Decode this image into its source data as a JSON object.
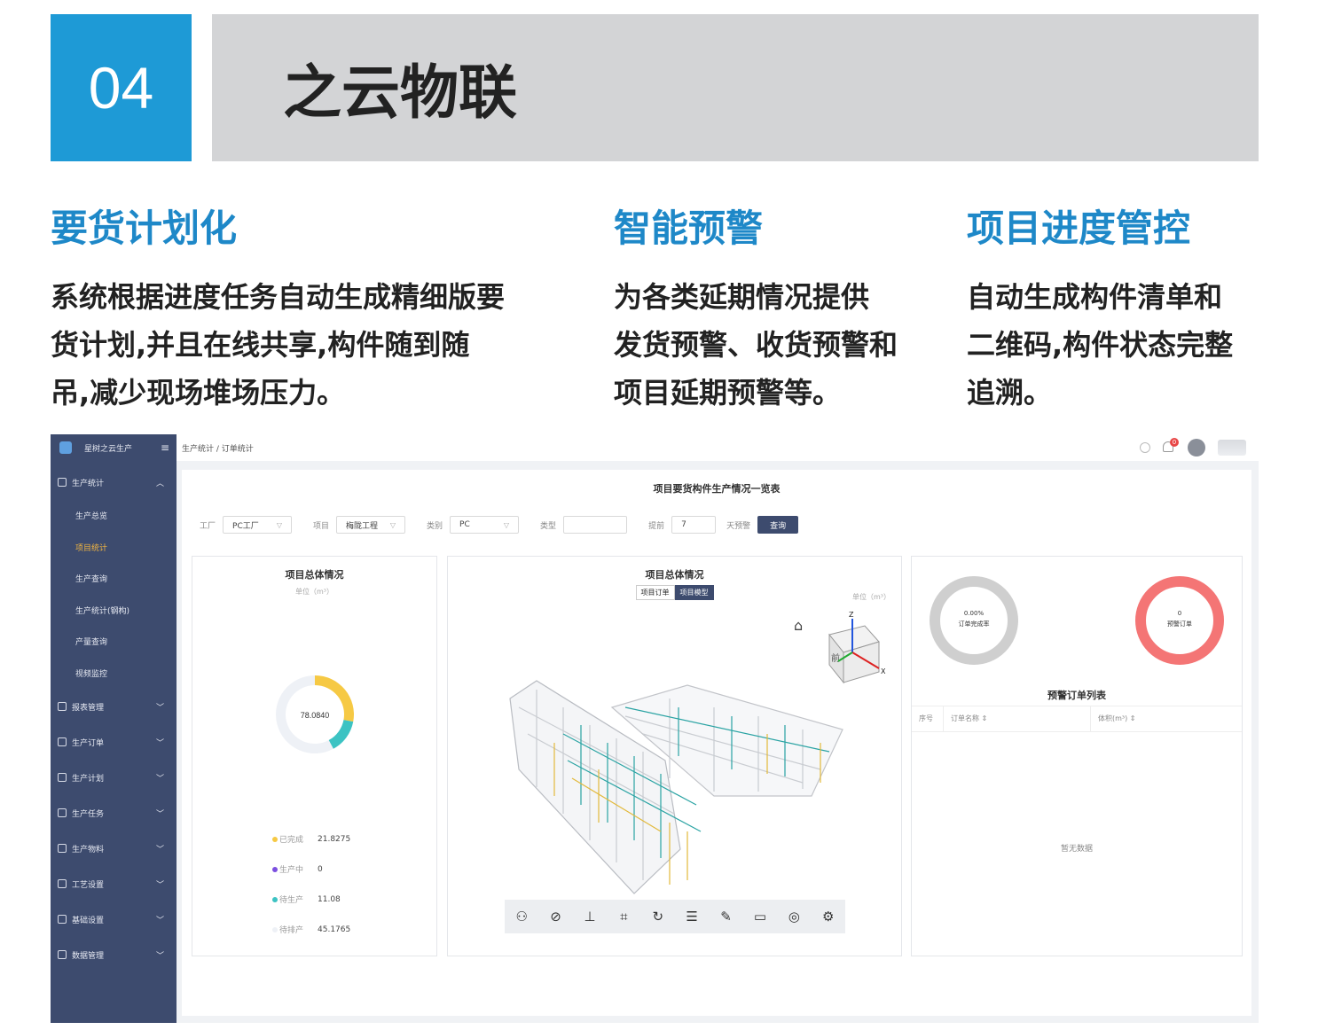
{
  "header": {
    "number": "04",
    "title": "之云物联"
  },
  "features": [
    {
      "title": "要货计划化",
      "desc": [
        "系统根据进度任务自动生成精细版要",
        "货计划,并且在线共享,构件随到随",
        "吊,减少现场堆场压力。"
      ]
    },
    {
      "title": "智能预警",
      "desc": [
        "为各类延期情况提供",
        "发货预警、收货预警和",
        "项目延期预警等。"
      ]
    },
    {
      "title": "项目进度管控",
      "desc": [
        "自动生成构件清单和",
        "二维码,构件状态完整",
        "追溯。"
      ]
    }
  ],
  "app": {
    "brand": "星树之云生产",
    "breadcrumb": "生产统计 / 订单统计",
    "notification_count": "0",
    "sidebar": {
      "group": "生产统计",
      "subitems": [
        "生产总览",
        "项目统计",
        "生产查询",
        "生产统计(钢构)",
        "产量查询",
        "视频监控"
      ],
      "active_sub": "项目统计",
      "items": [
        "报表管理",
        "生产订单",
        "生产计划",
        "生产任务",
        "生产物料",
        "工艺设置",
        "基础设置",
        "数据管理"
      ]
    },
    "page_title": "项目要货构件生产情况一览表",
    "filters": {
      "factory_label": "工厂",
      "factory_value": "PC工厂",
      "project_label": "项目",
      "project_value": "梅陇工程",
      "category_label": "类别",
      "category_value": "PC",
      "type_label": "类型",
      "type_value": "",
      "advance_label": "提前",
      "advance_value": "7",
      "days_warning_label": "天预警",
      "query_button": "查询"
    },
    "panel_left": {
      "title": "项目总体情况",
      "unit": "单位（m³）",
      "center_value": "78.0840",
      "legend": [
        {
          "label": "已完成",
          "value": "21.8275",
          "color": "#f6c944"
        },
        {
          "label": "生产中",
          "value": "0",
          "color": "#7b4fe0"
        },
        {
          "label": "待生产",
          "value": "11.08",
          "color": "#3cc3c3"
        },
        {
          "label": "待排产",
          "value": "45.1765",
          "color": "#eef1f6"
        }
      ]
    },
    "panel_mid": {
      "title": "项目总体情况",
      "tab_orders": "项目订单",
      "tab_model": "项目模型",
      "unit": "单位（m³）",
      "axis_x": "X",
      "axis_z": "Z",
      "cube_front": "前"
    },
    "panel_right": {
      "ring1_value": "0.00%",
      "ring1_label": "订单完成率",
      "ring2_value": "0",
      "ring2_label": "预警订单",
      "table_title": "预警订单列表",
      "columns": [
        "序号",
        "订单名称 ⇕",
        "体积(m³) ⇕"
      ],
      "empty_text": "暂无数据"
    }
  }
}
